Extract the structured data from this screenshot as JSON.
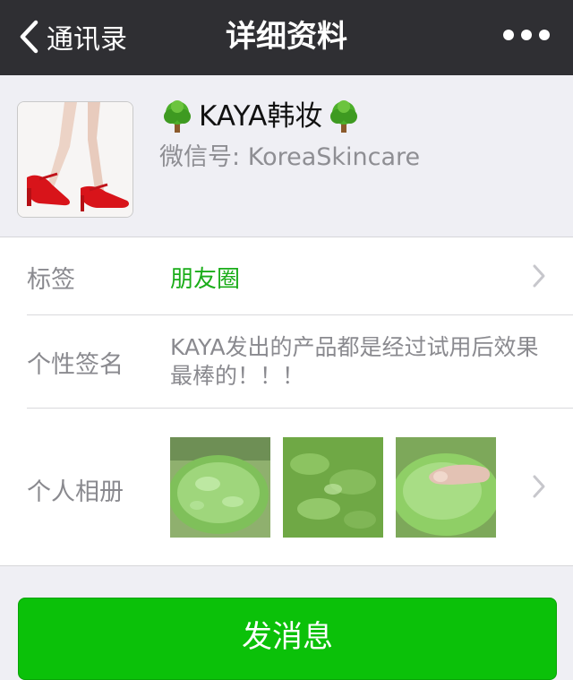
{
  "nav": {
    "back_label": "通讯录",
    "title": "详细资料",
    "more_icon": "ellipsis-icon"
  },
  "profile": {
    "name": "KAYA韩妆",
    "name_decoration_icon": "tree-icon",
    "wechat_id_label": "微信号:",
    "wechat_id_value": "KoreaSkincare"
  },
  "details": {
    "tag": {
      "label": "标签",
      "value": "朋友圈"
    },
    "signature": {
      "label": "个性签名",
      "value": "KAYA发出的产品都是经过试用后效果最棒的！！！"
    },
    "album": {
      "label": "个人相册"
    }
  },
  "actions": {
    "send_message": "发消息"
  },
  "colors": {
    "nav_bg": "#2f2f33",
    "page_bg": "#efeff4",
    "accent_green": "#1aad19",
    "button_green": "#0bc109"
  }
}
